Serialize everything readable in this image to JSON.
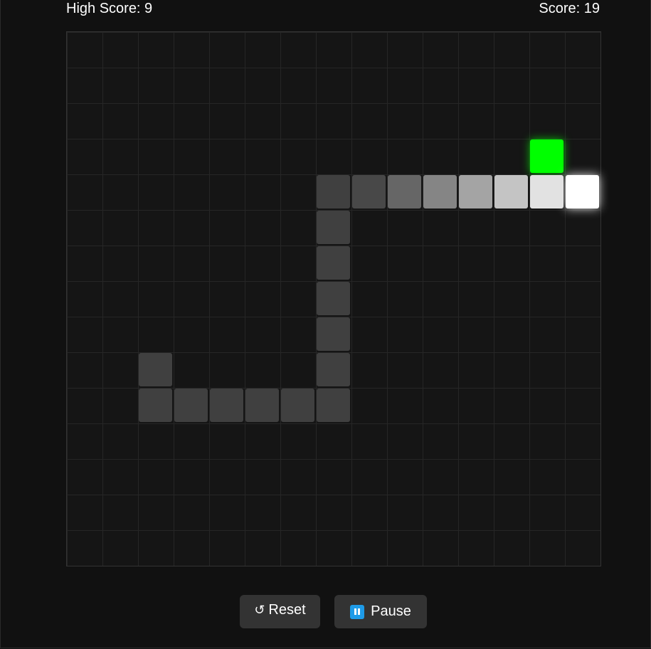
{
  "scoreboard": {
    "high_score_label": "High Score: 9",
    "score_label": "Score: 19",
    "high_score": 9,
    "score": 19
  },
  "board": {
    "columns": 15,
    "rows": 15,
    "food": {
      "col": 13,
      "row": 3,
      "color": "#00ff00"
    },
    "snake": [
      {
        "col": 14,
        "row": 4,
        "color": "#ffffff"
      },
      {
        "col": 13,
        "row": 4,
        "color": "#e2e2e2"
      },
      {
        "col": 12,
        "row": 4,
        "color": "#c4c4c4"
      },
      {
        "col": 11,
        "row": 4,
        "color": "#a4a4a4"
      },
      {
        "col": 10,
        "row": 4,
        "color": "#858585"
      },
      {
        "col": 9,
        "row": 4,
        "color": "#666666"
      },
      {
        "col": 8,
        "row": 4,
        "color": "#484848"
      },
      {
        "col": 7,
        "row": 4,
        "color": "#404040"
      },
      {
        "col": 7,
        "row": 5,
        "color": "#404040"
      },
      {
        "col": 7,
        "row": 6,
        "color": "#404040"
      },
      {
        "col": 7,
        "row": 7,
        "color": "#404040"
      },
      {
        "col": 7,
        "row": 8,
        "color": "#404040"
      },
      {
        "col": 7,
        "row": 9,
        "color": "#404040"
      },
      {
        "col": 7,
        "row": 10,
        "color": "#404040"
      },
      {
        "col": 6,
        "row": 10,
        "color": "#404040"
      },
      {
        "col": 5,
        "row": 10,
        "color": "#404040"
      },
      {
        "col": 4,
        "row": 10,
        "color": "#404040"
      },
      {
        "col": 3,
        "row": 10,
        "color": "#404040"
      },
      {
        "col": 2,
        "row": 10,
        "color": "#404040"
      },
      {
        "col": 2,
        "row": 9,
        "color": "#404040"
      }
    ]
  },
  "controls": {
    "reset": {
      "icon": "reset-icon",
      "glyph": "↺",
      "label": "Reset"
    },
    "pause": {
      "icon": "pause-icon",
      "label": "Pause",
      "icon_color": "#1e9be8"
    }
  }
}
